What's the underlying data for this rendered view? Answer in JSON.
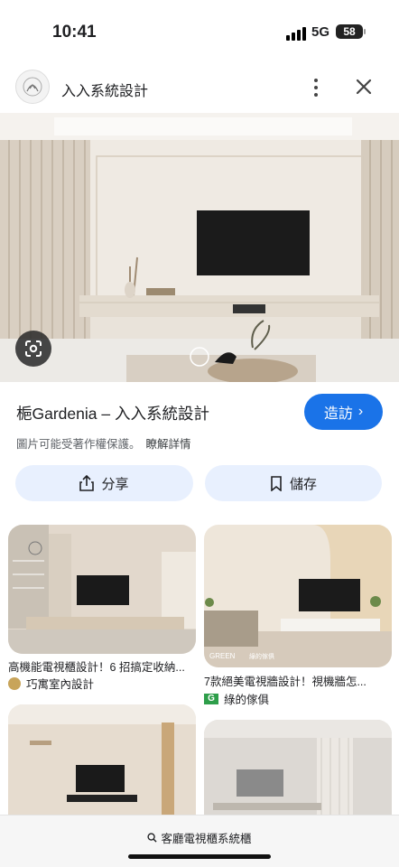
{
  "status": {
    "time": "10:41",
    "network": "5G",
    "battery": "58"
  },
  "header": {
    "site": "入入系統設計"
  },
  "main": {
    "title": "梔Gardenia – 入入系統設計",
    "visit": "造訪",
    "copyright": "圖片可能受著作權保護。",
    "learn_more": "瞭解詳情",
    "share": "分享",
    "save": "儲存"
  },
  "related": [
    {
      "caption": "高機能電視櫃設計！6 招搞定收納...",
      "source": "巧寓室內設計"
    },
    {
      "caption": "7款絕美電視牆設計！視機牆怎...",
      "source": "綠的傢俱",
      "watermark": "GREEN",
      "watermark_sub": "綠的傢俱"
    }
  ],
  "search": {
    "query": "客廳電視櫃系統櫃"
  },
  "colors": {
    "accent": "#1a73e8",
    "button_bg": "#e8f0fe"
  }
}
